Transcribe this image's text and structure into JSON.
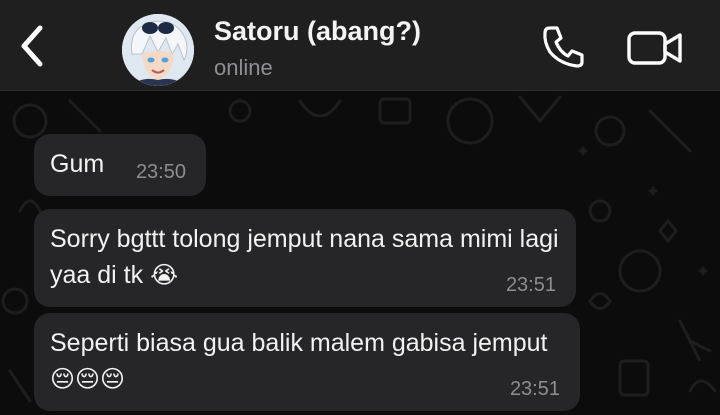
{
  "header": {
    "contact_name": "Satoru (abang?)",
    "contact_status": "online",
    "back_icon": "chevron-left-icon",
    "call_icon": "phone-icon",
    "video_icon": "video-camera-icon"
  },
  "messages": [
    {
      "text": "Gum",
      "emoji": "",
      "time": "23:50"
    },
    {
      "text": "Sorry bgttt tolong jemput nana sama mimi lagi yaa di tk",
      "emoji": "😭",
      "time": "23:51"
    },
    {
      "text": "Seperti biasa gua balik malem gabisa jemput",
      "emoji": "😔😔😔",
      "time": "23:51"
    }
  ],
  "colors": {
    "header_bg": "#1f1f1f",
    "chat_bg": "#0c0c0c",
    "bubble_bg": "#262628",
    "text": "#f2f2f2",
    "secondary_text": "#8e8e93"
  }
}
